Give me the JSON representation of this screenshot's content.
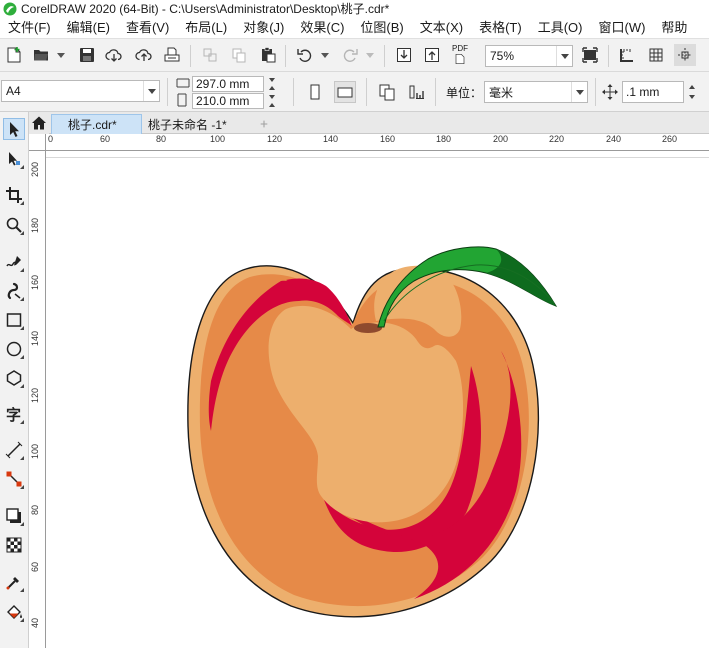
{
  "window": {
    "title": "CorelDRAW 2020 (64-Bit) - C:\\Users\\Administrator\\Desktop\\桃子.cdr*"
  },
  "menu": [
    "文件(F)",
    "编辑(E)",
    "查看(V)",
    "布局(L)",
    "对象(J)",
    "效果(C)",
    "位图(B)",
    "文本(X)",
    "表格(T)",
    "工具(O)",
    "窗口(W)",
    "帮助"
  ],
  "toolbar": {
    "zoom": "75%",
    "pdf_label": "PDF"
  },
  "property_bar": {
    "page_size": "A4",
    "width": "297.0 mm",
    "height": "210.0 mm",
    "units_label": "单位：",
    "units_value": "毫米",
    "nudge": ".1 mm"
  },
  "tabs": [
    "桃子.cdr*",
    "桃子未命名 -1*"
  ],
  "rulers": {
    "h_labels": [
      "0",
      "60",
      "80",
      "100",
      "120",
      "140",
      "160",
      "180",
      "200",
      "220",
      "240",
      "260"
    ],
    "v_labels": [
      "200",
      "180",
      "160",
      "140",
      "120",
      "100",
      "80",
      "60",
      "40"
    ]
  },
  "icons": {
    "app": "coreldraw-logo-icon",
    "tools": [
      "pick-tool-icon",
      "shape-tool-icon",
      "crop-tool-icon",
      "zoom-tool-icon",
      "freehand-tool-icon",
      "artistic-media-tool-icon",
      "rectangle-tool-icon",
      "ellipse-tool-icon",
      "polygon-tool-icon",
      "text-tool-icon",
      "parallel-dimension-tool-icon",
      "connector-tool-icon",
      "drop-shadow-tool-icon",
      "transparency-tool-icon",
      "eyedropper-tool-icon",
      "interactive-fill-tool-icon"
    ]
  },
  "colors": {
    "peach_body": "#E68A48",
    "peach_light": "#EDAF6D",
    "peach_red": "#D4043A",
    "leaf_green": "#22A533",
    "leaf_dark": "#0E6B1E",
    "stem": "#8F4A2E",
    "tab_active": "#CDE3F7"
  }
}
